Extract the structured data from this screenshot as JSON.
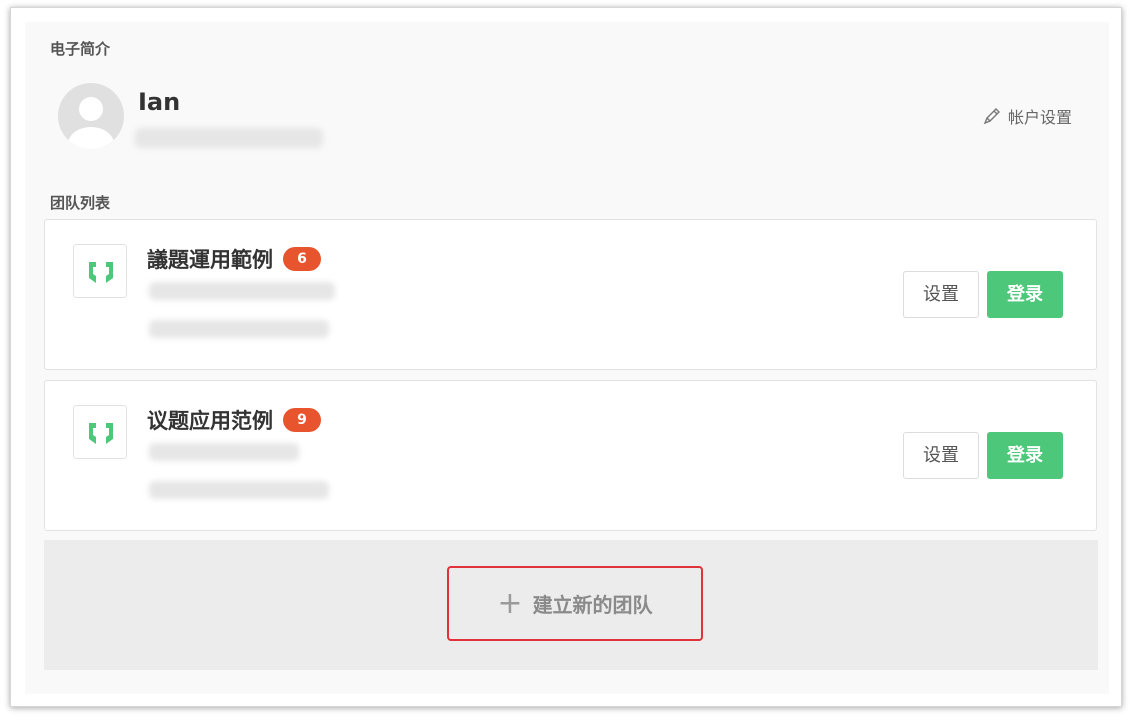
{
  "profile": {
    "section_label": "电子简介",
    "name": "Ian",
    "account_settings_label": "帐户设置"
  },
  "teams": {
    "section_label": "团队列表",
    "items": [
      {
        "name": "議題運用範例",
        "badge": "6",
        "settings_label": "设置",
        "login_label": "登录"
      },
      {
        "name": "议题应用范例",
        "badge": "9",
        "settings_label": "设置",
        "login_label": "登录"
      }
    ],
    "create_label": "建立新的团队"
  },
  "colors": {
    "accent_green": "#4dc87a",
    "badge_orange": "#e8542e",
    "highlight_red": "#e0323a"
  }
}
